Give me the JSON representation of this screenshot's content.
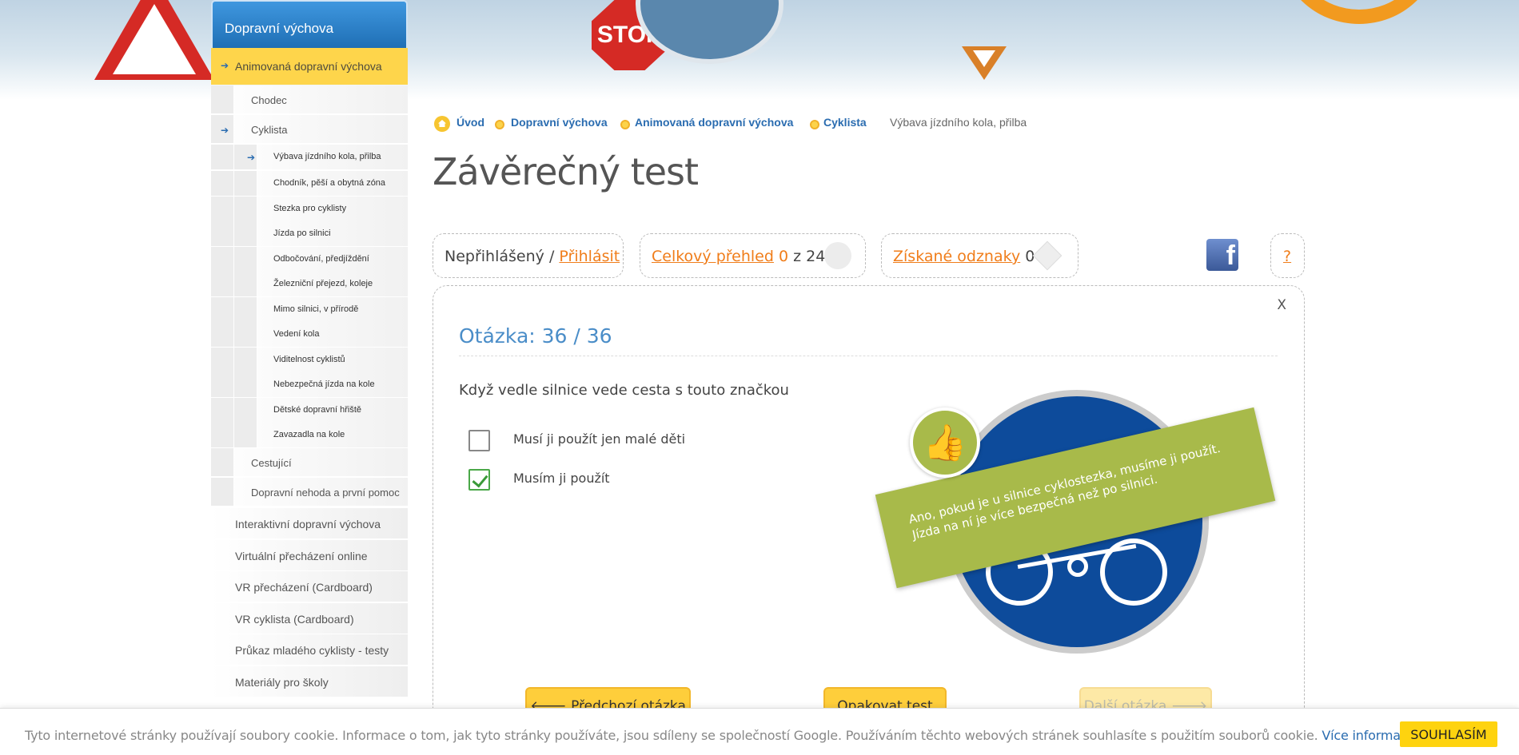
{
  "sidebar": {
    "title": "Dopravní výchova",
    "active": "Animovaná dopravní výchova",
    "sub": [
      {
        "label": "Chodec"
      },
      {
        "label": "Cyklista"
      }
    ],
    "cyclist_items": [
      "Výbava jízdního kola, přilba",
      "Chodník, pěší a obytná zóna",
      "Stezka pro cyklisty",
      "Jízda po silnici",
      "Odbočování, předjíždění",
      "Železniční přejezd, koleje",
      "Mimo silnici, v přírodě",
      "Vedení kola",
      "Viditelnost cyklistů",
      "Nebezpečná jízda na kole",
      "Dětské dopravní hřiště",
      "Zavazadla na kole"
    ],
    "sub_after": [
      "Cestující",
      "Dopravní nehoda a první pomoc"
    ],
    "top_items": [
      "Interaktivní dopravní výchova",
      "Virtuální přecházení online",
      "VR přecházení (Cardboard)",
      "VR cyklista (Cardboard)",
      "Průkaz mladého cyklisty - testy",
      "Materiály pro školy"
    ]
  },
  "breadcrumb": [
    "Úvod",
    "Dopravní výchova",
    "Animovaná dopravní výchova",
    "Cyklista",
    "Výbava jízdního kola, přilba"
  ],
  "page_title": "Závěrečný test",
  "login": {
    "status": "Nepřihlášený",
    "sep": "/",
    "link": "Přihlásit"
  },
  "overview": {
    "link": "Celkový přehled",
    "score": "0",
    "of": "z 24"
  },
  "badges": {
    "link": "Získané odznaky",
    "count": "0"
  },
  "help_label": "?",
  "hero_stop": "STOP",
  "quiz": {
    "close": "X",
    "header": "Otázka: 36 / 36",
    "question": "Když vedle silnice vede cesta s touto značkou",
    "options": [
      {
        "label": "Musí ji použít jen malé děti",
        "checked": false
      },
      {
        "label": "Musím ji použít",
        "checked": true
      }
    ],
    "feedback": "Ano, pokud je u silnice cyklostezka, musíme ji použít. Jízda na ní je více bezpečná než po silnici.",
    "prev": "Předchozí otázka",
    "repeat": "Opakovat test",
    "next": "Další otázka"
  },
  "cookie": {
    "message": "Tyto internetové stránky používají soubory cookie. Informace o tom, jak tyto stránky používáte, jsou sdíleny se společností Google. Používáním těchto webových stránek souhlasíte s použitím souborů cookie.",
    "more": "Více informací",
    "agree": "SOUHLASÍM"
  },
  "colors": {
    "accent_blue": "#2a6cb0",
    "accent_orange": "#f07d1a",
    "yellow": "#fed54b",
    "answer_green": "#a8ba4a"
  }
}
